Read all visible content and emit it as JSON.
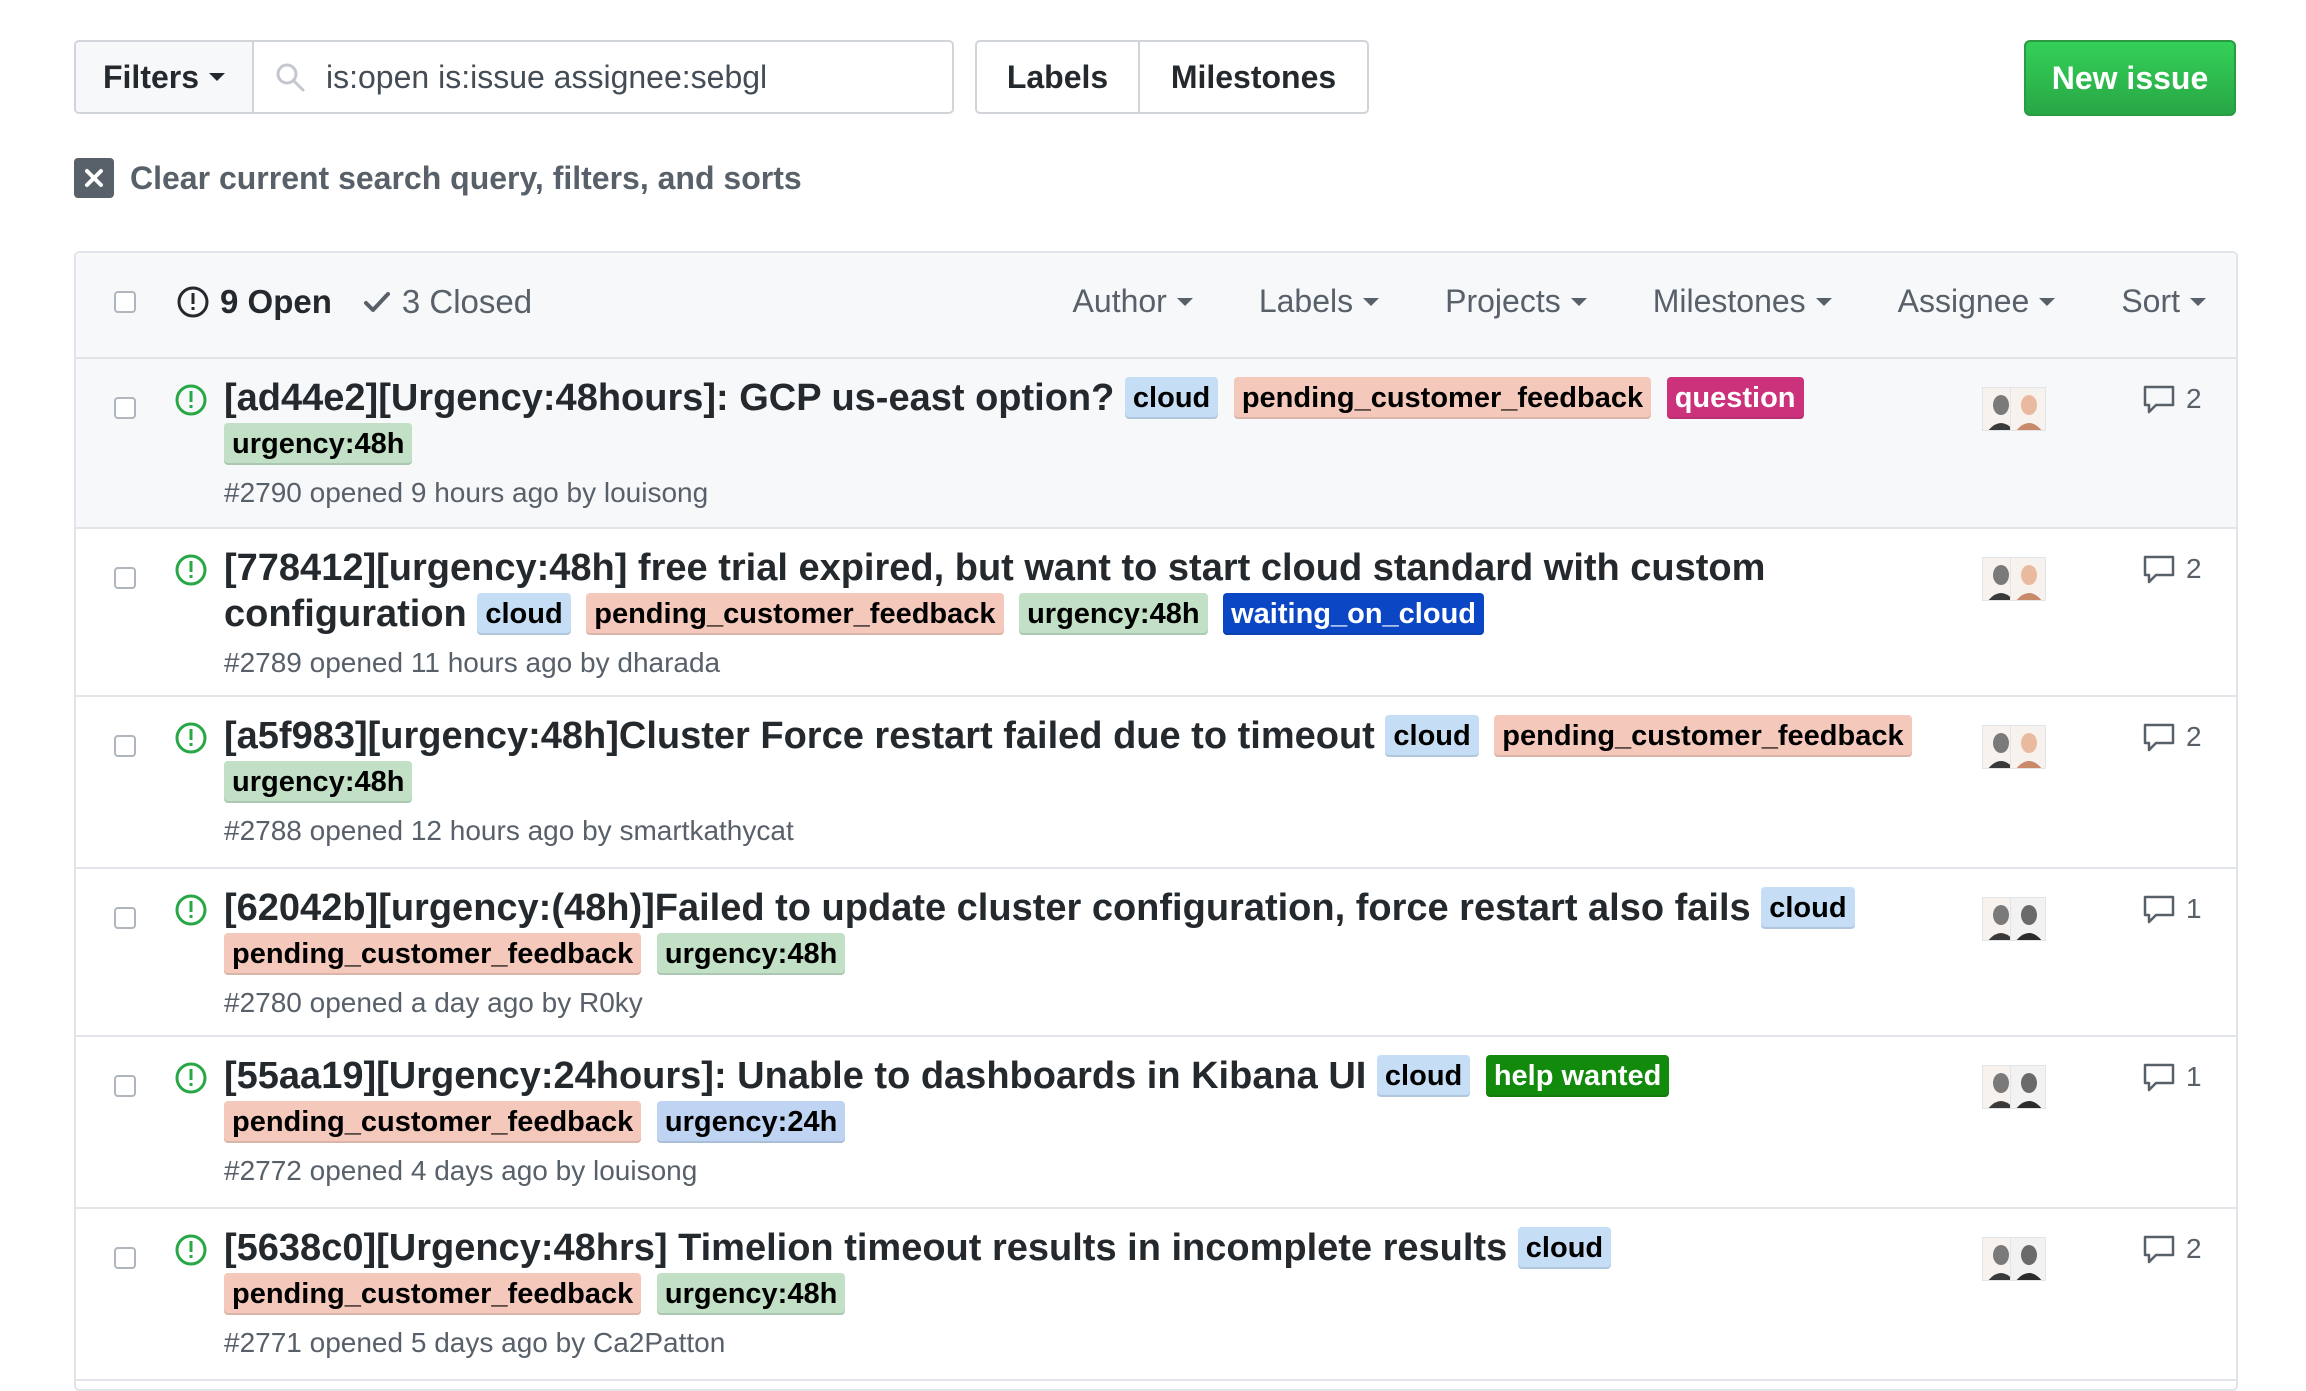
{
  "toolbar": {
    "filters_label": "Filters",
    "search_value": "is:open is:issue assignee:sebgl",
    "labels_label": "Labels",
    "milestones_label": "Milestones",
    "new_issue_label": "New issue"
  },
  "clear_filters": {
    "label": "Clear current search query, filters, and sorts"
  },
  "issues_header": {
    "open_count": "9 Open",
    "closed_count": "3 Closed",
    "menus": [
      "Author",
      "Labels",
      "Projects",
      "Milestones",
      "Assignee",
      "Sort"
    ]
  },
  "issues": [
    {
      "title": "[ad44e2][Urgency:48hours]: GCP us-east option?",
      "labels": [
        {
          "text": "cloud",
          "kind": "cloud"
        },
        {
          "text": "pending_customer_feedback",
          "kind": "pending"
        },
        {
          "text": "question",
          "kind": "question"
        },
        {
          "text": "urgency:48h",
          "kind": "u48"
        }
      ],
      "meta": "#2790 opened 9 hours ago by louisong",
      "comments": "2"
    },
    {
      "title": "[778412][urgency:48h] free trial expired, but want to start cloud standard with custom configuration",
      "labels": [
        {
          "text": "cloud",
          "kind": "cloud"
        },
        {
          "text": "pending_customer_feedback",
          "kind": "pending"
        },
        {
          "text": "urgency:48h",
          "kind": "u48"
        },
        {
          "text": "waiting_on_cloud",
          "kind": "waiting"
        }
      ],
      "meta": "#2789 opened 11 hours ago by dharada",
      "comments": "2"
    },
    {
      "title": "[a5f983][urgency:48h]Cluster Force restart failed due to timeout",
      "labels": [
        {
          "text": "cloud",
          "kind": "cloud"
        },
        {
          "text": "pending_customer_feedback",
          "kind": "pending"
        },
        {
          "text": "urgency:48h",
          "kind": "u48"
        }
      ],
      "meta": "#2788 opened 12 hours ago by smartkathycat",
      "comments": "2"
    },
    {
      "title": "[62042b][urgency:(48h)]Failed to update cluster configuration, force restart also fails",
      "labels": [
        {
          "text": "cloud",
          "kind": "cloud"
        },
        {
          "text": "pending_customer_feedback",
          "kind": "pending"
        },
        {
          "text": "urgency:48h",
          "kind": "u48"
        }
      ],
      "meta": "#2780 opened a day ago by R0ky",
      "comments": "1"
    },
    {
      "title": "[55aa19][Urgency:24hours]: Unable to dashboards in Kibana UI",
      "labels": [
        {
          "text": "cloud",
          "kind": "cloud"
        },
        {
          "text": "help wanted",
          "kind": "help"
        },
        {
          "text": "pending_customer_feedback",
          "kind": "pending"
        },
        {
          "text": "urgency:24h",
          "kind": "u24"
        }
      ],
      "meta": "#2772 opened 4 days ago by louisong",
      "comments": "1"
    },
    {
      "title": "[5638c0][Urgency:48hrs] Timelion timeout results in incomplete results",
      "labels": [
        {
          "text": "cloud",
          "kind": "cloud"
        },
        {
          "text": "pending_customer_feedback",
          "kind": "pending"
        },
        {
          "text": "urgency:48h",
          "kind": "u48"
        }
      ],
      "meta": "#2771 opened 5 days ago by Ca2Patton",
      "comments": "2"
    }
  ],
  "colors": {
    "accent_green": "#28a745",
    "open_icon": "#28a745",
    "label_cloud": "#c5def5",
    "label_pending": "#f4c9bb",
    "label_question": "#cc317c",
    "label_urgency_48h": "#c2e0c6",
    "label_urgency_24h": "#bfd4f2",
    "label_waiting": "#0b46c4",
    "label_help": "#128a0c"
  },
  "icons": {
    "search": "search-icon",
    "caret": "caret-down-icon",
    "clear": "close-icon",
    "open_issue": "issue-opened-icon",
    "check": "check-icon",
    "comment": "comment-icon"
  }
}
